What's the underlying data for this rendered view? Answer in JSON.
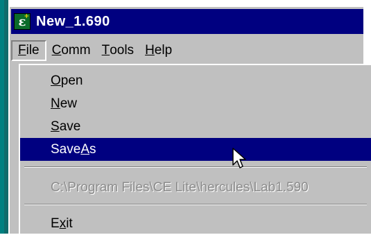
{
  "window": {
    "title": "New_1.690",
    "icon": "ce-app-icon"
  },
  "menubar": {
    "items": [
      {
        "label": "File",
        "mnemonic": "F",
        "rest": "ile"
      },
      {
        "label": "Comm",
        "mnemonic": "C",
        "rest": "omm"
      },
      {
        "label": "Tools",
        "mnemonic": "T",
        "rest": "ools"
      },
      {
        "label": "Help",
        "mnemonic": "H",
        "rest": "elp"
      }
    ]
  },
  "file_menu": {
    "open": {
      "pre": "",
      "mnemonic": "O",
      "post": "pen"
    },
    "new": {
      "pre": "",
      "mnemonic": "N",
      "post": "ew"
    },
    "save": {
      "pre": "",
      "mnemonic": "S",
      "post": "ave"
    },
    "save_as": {
      "pre": "Save",
      "mnemonic": "A",
      "post": "s"
    },
    "recent_file": "C:\\Program Files\\CE Lite\\hercules\\Lab1.590",
    "exit": {
      "pre": "E",
      "mnemonic": "x",
      "post": "it"
    }
  },
  "colors": {
    "titlebar": "#000080",
    "highlight": "#000080",
    "menu_bg": "#c0c0c0"
  }
}
